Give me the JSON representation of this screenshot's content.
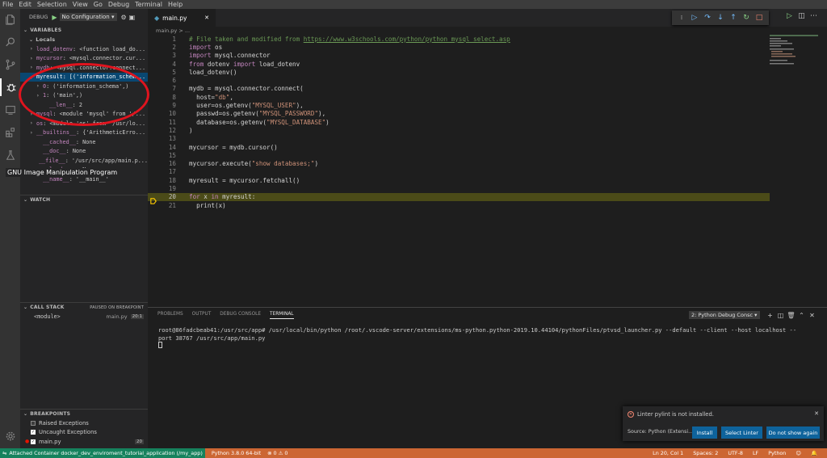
{
  "menu": [
    "File",
    "Edit",
    "Selection",
    "View",
    "Go",
    "Debug",
    "Terminal",
    "Help"
  ],
  "debug": {
    "label": "DEBUG",
    "config": "No Configuration",
    "config_arrow": "▾"
  },
  "sections": {
    "variables": "VARIABLES",
    "locals": "Locals",
    "watch": "WATCH",
    "call_stack": "CALL STACK",
    "paused": "PAUSED ON BREAKPOINT",
    "breakpoints": "BREAKPOINTS"
  },
  "variables": [
    {
      "name": "load_dotenv",
      "value": ": <function load_do...",
      "arrow": "›",
      "indent": 12,
      "selected": false
    },
    {
      "name": "mycursor",
      "value": ": <mysql.connector.cur...",
      "arrow": "›",
      "indent": 12,
      "selected": false
    },
    {
      "name": "mydb",
      "value": ": <mysql.connector.connect...",
      "arrow": "›",
      "indent": 12,
      "selected": false
    },
    {
      "name": "myresult",
      "value": ": [('information_schem...",
      "arrow": "⌄",
      "indent": 12,
      "selected": true
    },
    {
      "name": "0",
      "value": ": ('information_schema',)",
      "arrow": "›",
      "indent": 20,
      "selected": false
    },
    {
      "name": "1",
      "value": ": ('main',)",
      "arrow": "›",
      "indent": 20,
      "selected": false
    },
    {
      "name": "__len__",
      "value": ": 2",
      "arrow": "",
      "indent": 28,
      "selected": false
    },
    {
      "name": "mysql",
      "value": ": <module 'mysql' from '/...",
      "arrow": "›",
      "indent": 12,
      "selected": false
    },
    {
      "name": "os",
      "value": ": <module 'os' from '/usr/lo...",
      "arrow": "›",
      "indent": 12,
      "selected": false
    },
    {
      "name": "__builtins__",
      "value": ": {'ArithmeticErro...",
      "arrow": "›",
      "indent": 12,
      "selected": false
    },
    {
      "name": "__cached__",
      "value": ": None",
      "arrow": "",
      "indent": 20,
      "selected": false
    },
    {
      "name": "__doc__",
      "value": ": None",
      "arrow": "",
      "indent": 20,
      "selected": false
    },
    {
      "name": "__file__",
      "value": ": '/usr/src/app/main.p...",
      "arrow": "",
      "indent": 20,
      "selected": false
    },
    {
      "name": "__loader__",
      "value": ": None",
      "arrow": "",
      "indent": 20,
      "selected": false
    },
    {
      "name": "__name__",
      "value": ": '__main__'",
      "arrow": "",
      "indent": 20,
      "selected": false
    }
  ],
  "call_stack": {
    "frame": "<module>",
    "file": "main.py",
    "pos": "20:1"
  },
  "breakpoints": [
    {
      "label": "Raised Exceptions",
      "checked": false
    },
    {
      "label": "Uncaught Exceptions",
      "checked": true
    },
    {
      "label": "main.py",
      "checked": true,
      "line": "20"
    }
  ],
  "tooltip": "GNU Image Manipulation Program",
  "tab": {
    "label": "main.py"
  },
  "breadcrumb": "main.py > ...",
  "code": [
    {
      "n": "1",
      "html": "<span class='cm'># File taken and modified from </span><span class='lnk'>https://www.w3schools.com/python/python_mysql_select.asp</span>"
    },
    {
      "n": "2",
      "html": "<span class='kw'>import</span> os"
    },
    {
      "n": "3",
      "html": "<span class='kw'>import</span> mysql.connector"
    },
    {
      "n": "4",
      "html": "<span class='kw'>from</span> dotenv <span class='kw'>import</span> load_dotenv"
    },
    {
      "n": "5",
      "html": "load_dotenv()"
    },
    {
      "n": "6",
      "html": ""
    },
    {
      "n": "7",
      "html": "mydb = mysql.connector.connect("
    },
    {
      "n": "8",
      "html": "  host=<span class='st'>\"db\"</span>,"
    },
    {
      "n": "9",
      "html": "  user=os.getenv(<span class='st'>\"MYSQL_USER\"</span>),"
    },
    {
      "n": "10",
      "html": "  passwd=os.getenv(<span class='st'>\"MYSQL_PASSWORD\"</span>),"
    },
    {
      "n": "11",
      "html": "  database=os.getenv(<span class='st'>\"MYSQL_DATABASE\"</span>)"
    },
    {
      "n": "12",
      "html": ")"
    },
    {
      "n": "13",
      "html": ""
    },
    {
      "n": "14",
      "html": "mycursor = mydb.cursor()"
    },
    {
      "n": "15",
      "html": ""
    },
    {
      "n": "16",
      "html": "mycursor.execute(<span class='st'>\"show databases;\"</span>)"
    },
    {
      "n": "17",
      "html": ""
    },
    {
      "n": "18",
      "html": "myresult = mycursor.fetchall()"
    },
    {
      "n": "19",
      "html": ""
    },
    {
      "n": "20",
      "html": "<span class='kw'>for</span> x <span class='kw'>in</span> myresult:"
    },
    {
      "n": "21",
      "html": "  print(x)"
    }
  ],
  "current_line": "20",
  "panel": {
    "tabs": [
      "PROBLEMS",
      "OUTPUT",
      "DEBUG CONSOLE",
      "TERMINAL"
    ],
    "active_tab": "TERMINAL",
    "terminal_select": "2: Python Debug Consc ▾",
    "terminal_lines": [
      "root@86fadcbeab41:/usr/src/app# /usr/local/bin/python /root/.vscode-server/extensions/ms-python.python-2019.10.44104/pythonFiles/ptvsd_launcher.py --default --client --host localhost --",
      "port 38767 /usr/src/app/main.py"
    ]
  },
  "notification": {
    "message": "Linter pylint is not installed.",
    "source": "Source: Python (Extensi...",
    "buttons": [
      "Install",
      "Select Linter",
      "Do not show again"
    ]
  },
  "status": {
    "remote": "Attached Container docker_dev_enviroment_tutorial_application (/my_app)",
    "python": "Python 3.8.0 64-bit",
    "problems": "⊗ 0 ⚠ 0",
    "position": "Ln 20, Col 1",
    "spaces": "Spaces: 2",
    "encoding": "UTF-8",
    "eol": "LF",
    "language": "Python"
  },
  "colors": {
    "status_bar": "#cc6633",
    "remote": "#16825d",
    "selection": "#094771",
    "annotation": "#e0141e"
  }
}
